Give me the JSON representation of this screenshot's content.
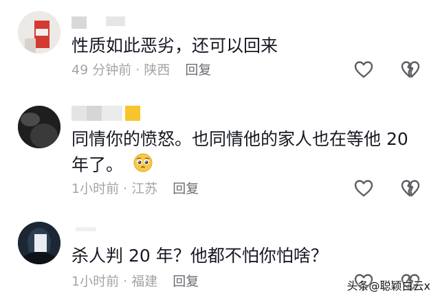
{
  "comments": [
    {
      "text_lines": [
        "性质如此恶劣，还可以回来"
      ],
      "time": "49 分钟前",
      "location": "陕西",
      "reply_label": "回复",
      "like_icon": "heart-outline-icon",
      "dislike_icon": "broken-heart-icon"
    },
    {
      "text_lines": [
        "同情你的愤怒。也同情他的家人也在等他 20",
        "年了。"
      ],
      "emoji": "pleading-face-emoji",
      "time": "1小时前",
      "location": "江苏",
      "reply_label": "回复",
      "like_icon": "heart-outline-icon",
      "dislike_icon": "broken-heart-icon"
    },
    {
      "text_lines": [
        "杀人判 20 年？他都不怕你怕啥？"
      ],
      "time": "1小时前",
      "location": "福建",
      "reply_label": "回复",
      "like_icon": "heart-outline-icon",
      "dislike_icon": "broken-heart-icon"
    }
  ],
  "watermark": "头条@聪颖白云x",
  "colors": {
    "text": "#161823",
    "meta": "#a3a4a8",
    "reply": "#6b6c71",
    "icon": "#5c5d62"
  }
}
